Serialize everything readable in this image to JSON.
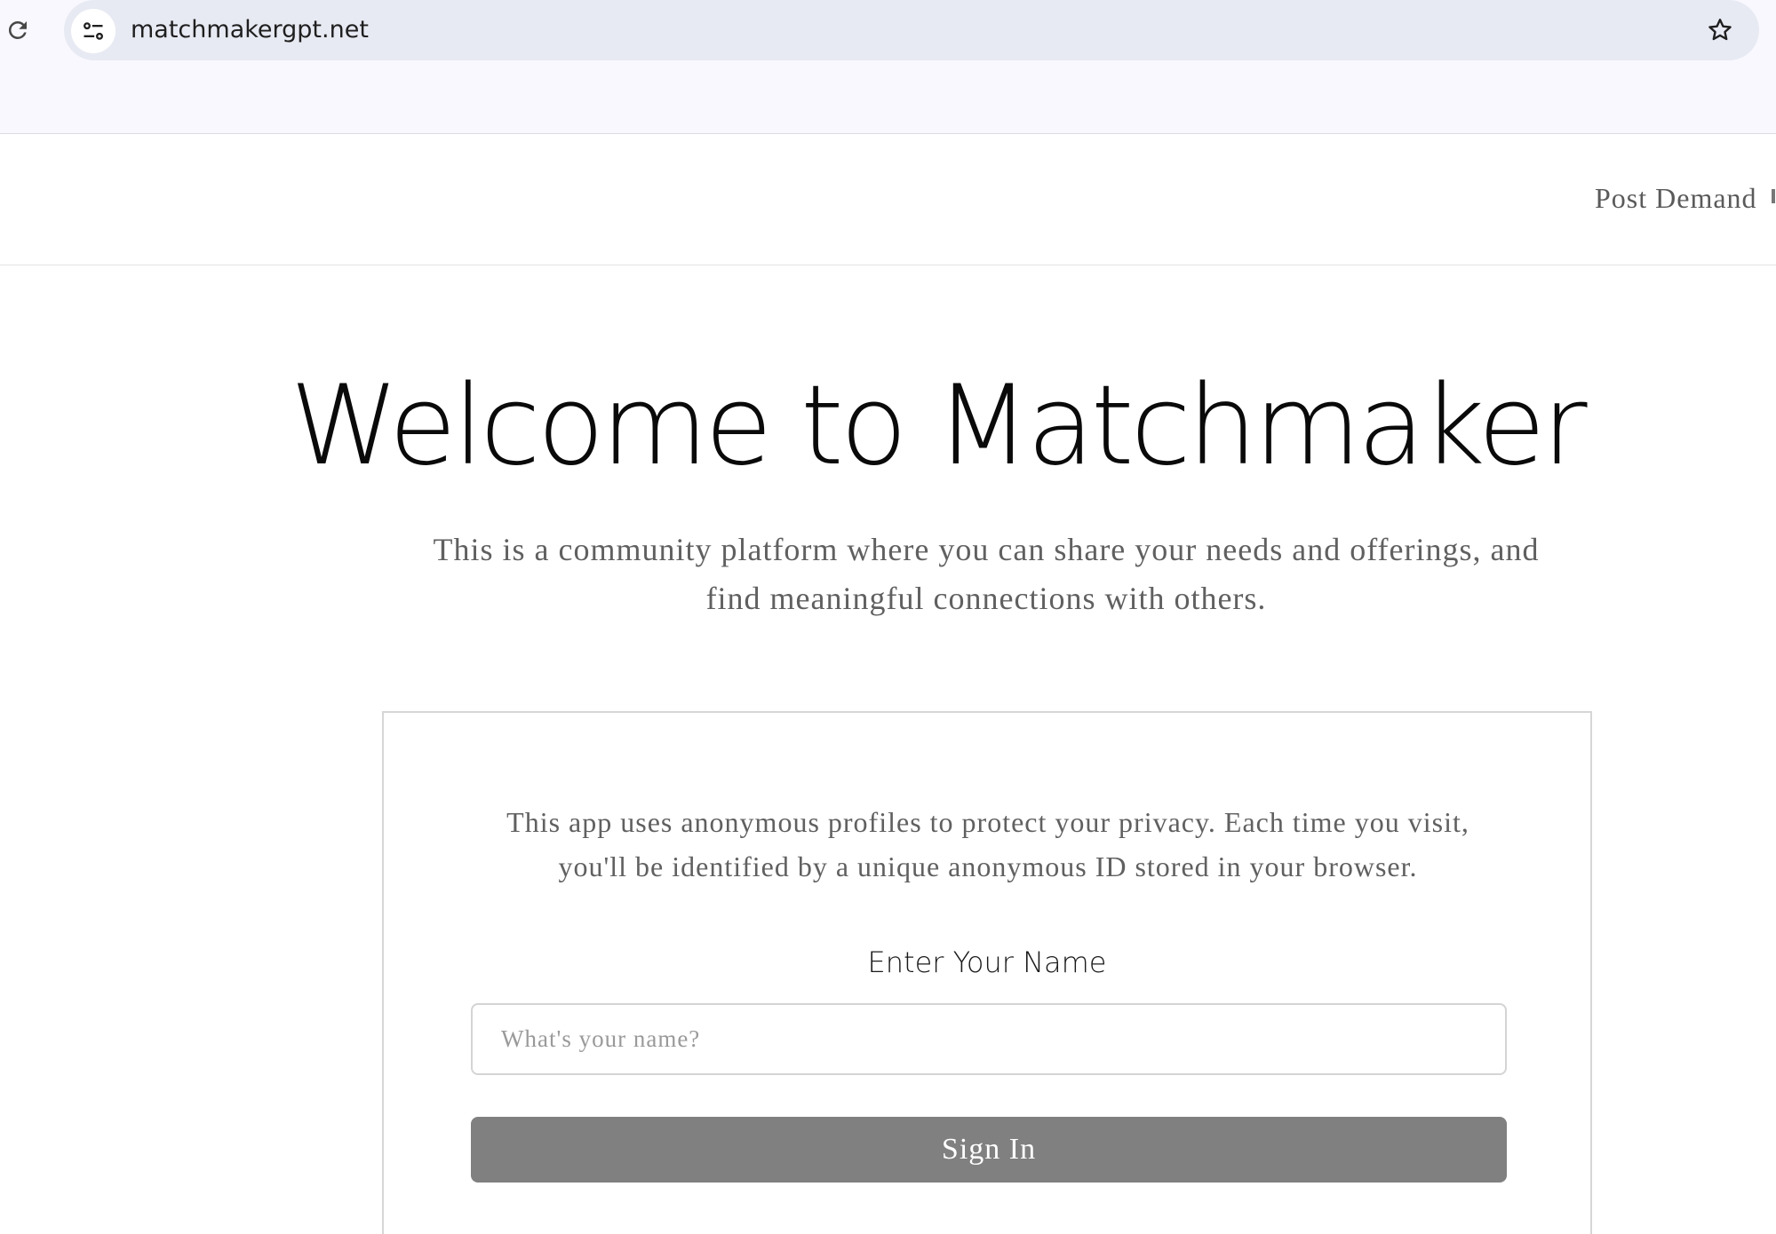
{
  "browser": {
    "url": "matchmakergpt.net",
    "icons": {
      "reload": "reload-icon",
      "site_info": "tune-icon",
      "bookmark": "star-icon"
    }
  },
  "header": {
    "nav": {
      "post_demand": "Post Demand"
    }
  },
  "hero": {
    "title": "Welcome to Matchmaker",
    "subtitle": "This is a community platform where you can share your needs and offerings, and find meaningful connections with others."
  },
  "signin_card": {
    "privacy_note": "This app uses anonymous profiles to protect your privacy. Each time you visit, you'll be identified by a unique anonymous ID stored in your browser.",
    "name_label": "Enter Your Name",
    "name_placeholder": "What's your name?",
    "name_value": "",
    "button_label": "Sign In"
  },
  "colors": {
    "button_bg": "#808080",
    "omnibox_bg": "#e8eaf3",
    "text_muted": "#606060"
  }
}
